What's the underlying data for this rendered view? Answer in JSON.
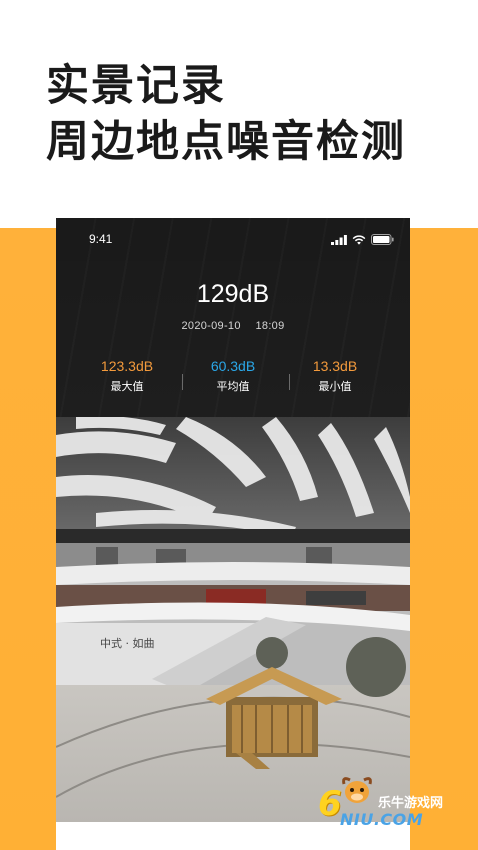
{
  "headline": {
    "line1": "实景记录",
    "line2": "周边地点噪音检测"
  },
  "status_bar": {
    "time": "9:41"
  },
  "reading": {
    "value": "129dB",
    "date": "2020-09-10",
    "time": "18:09"
  },
  "stats": [
    {
      "value": "123.3dB",
      "label": "最大值",
      "color": "#f39a3c"
    },
    {
      "value": "60.3dB",
      "label": "平均值",
      "color": "#2aa7e8"
    },
    {
      "value": "13.3dB",
      "label": "最小值",
      "color": "#f39a3c"
    }
  ],
  "photo": {
    "signage": "中式 · 如曲"
  },
  "watermark": {
    "brand": "乐牛游戏网",
    "domain": "NIU.COM",
    "digit": "6"
  },
  "colors": {
    "accent_orange": "#ffb13a",
    "dark_panel": "#1e1e1e"
  }
}
